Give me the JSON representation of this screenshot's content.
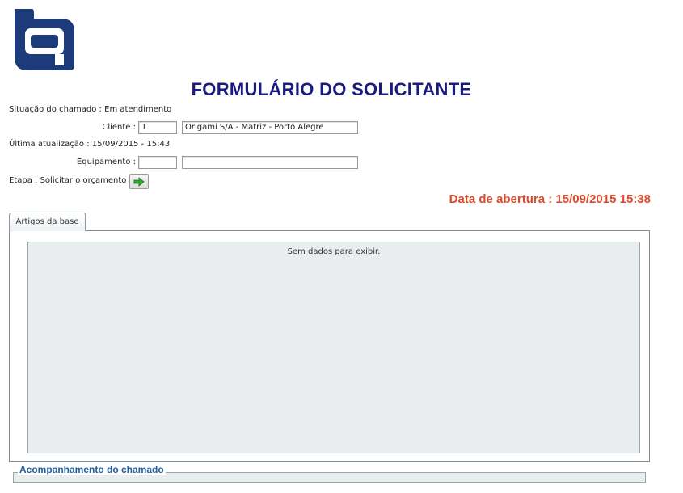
{
  "logo": {
    "icon": "origami-q-logo-icon",
    "color": "#1d3a7a"
  },
  "title": "FORMULÁRIO DO SOLICITANTE",
  "status": {
    "label": "Situação do chamado :",
    "value": "Em atendimento"
  },
  "client": {
    "label": "Cliente :",
    "code": "1",
    "name": "Origami S/A - Matriz - Porto Alegre"
  },
  "last_update": {
    "label": "Última atualização :",
    "value": "15/09/2015 - 15:43"
  },
  "equipment": {
    "label": "Equipamento :",
    "code": "",
    "name": ""
  },
  "step": {
    "label": "Etapa :",
    "value": "Solicitar o orçamento",
    "button_icon": "green-arrow-right-icon"
  },
  "opening_date": {
    "label": "Data de abertura :",
    "value": "15/09/2015 15:38",
    "color": "#e04a2a"
  },
  "tabs": [
    {
      "label": "Artigos da base",
      "active": true
    }
  ],
  "grid": {
    "empty_message": "Sem dados para exibir."
  },
  "tracking": {
    "legend": "Acompanhamento do chamado"
  },
  "colors": {
    "title": "#1a1a80",
    "accent": "#1f5f9e",
    "panel_bg": "#e9edee"
  }
}
